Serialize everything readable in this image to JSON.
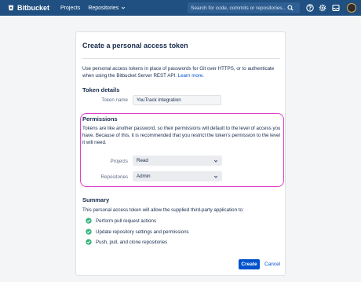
{
  "header": {
    "brand": "Bitbucket",
    "nav": [
      {
        "label": "Projects"
      },
      {
        "label": "Repositories"
      }
    ],
    "search": {
      "placeholder": "Search for code, commits or repositories..."
    }
  },
  "page": {
    "title": "Create a personal access token",
    "intro_text": "Use personal access tokens in place of passwords for Git over HTTPS, or to authenticate when using the Bitbucket Server REST API.",
    "learn_more": "Learn more.",
    "token_details": {
      "heading": "Token details",
      "name_label": "Token name",
      "name_value": "YouTrack Integration"
    },
    "permissions": {
      "heading": "Permissions",
      "description": "Tokens are like another password, so their permissions will default to the level of access you have. Because of this, it is recommended that you restrict the token's permission to the level it will need.",
      "projects_label": "Projects",
      "projects_value": "Read",
      "repositories_label": "Repositories",
      "repositories_value": "Admin"
    },
    "summary": {
      "heading": "Summary",
      "text": "This personal access token will allow the supplied third-party application to:",
      "items": [
        "Perform pull request actions",
        "Update repository settings and permissions",
        "Push, pull, and clone repositories"
      ]
    },
    "actions": {
      "create": "Create",
      "cancel": "Cancel"
    }
  },
  "colors": {
    "header": "#205081",
    "primary": "#0052cc",
    "success": "#36b37e",
    "highlight": "#e040c8"
  }
}
